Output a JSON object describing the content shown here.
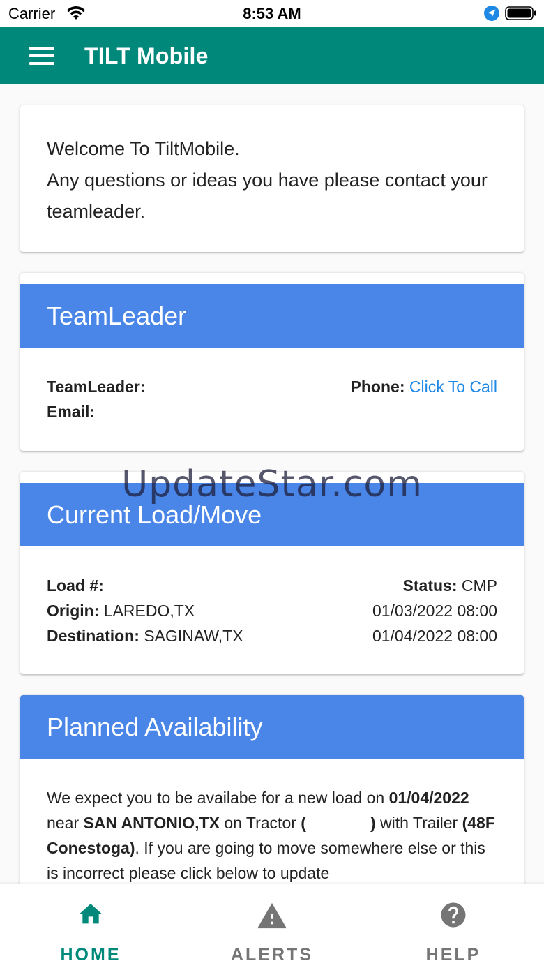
{
  "status_bar": {
    "carrier": "Carrier",
    "time": "8:53 AM"
  },
  "app_bar": {
    "title": "TILT Mobile",
    "menu_icon": "hamburger-menu-icon",
    "color": "#00897B"
  },
  "welcome": {
    "line1": "Welcome To TiltMobile.",
    "line2": "Any questions or ideas you have please contact your teamleader."
  },
  "teamleader": {
    "header": "TeamLeader",
    "teamleader_label": "TeamLeader:",
    "teamleader_value": "",
    "email_label": "Email:",
    "email_value": "",
    "phone_label": "Phone:",
    "phone_link": "Click To Call"
  },
  "current_load": {
    "header": "Current Load/Move",
    "load_label": "Load #:",
    "load_value": "",
    "status_label": "Status:",
    "status_value": "CMP",
    "origin_label": "Origin:",
    "origin_value": "LAREDO,TX",
    "origin_datetime": "01/03/2022 08:00",
    "destination_label": "Destination:",
    "destination_value": "SAGINAW,TX",
    "destination_datetime": "01/04/2022 08:00"
  },
  "planned_availability": {
    "header": "Planned Availability",
    "text_1": "We expect you to be availabe for a new load on ",
    "date": "01/04/2022",
    "text_2": " near ",
    "location": "SAN ANTONIO,TX",
    "text_3": " on Tractor ",
    "tractor_open": "(",
    "tractor_close": ")",
    "text_4": " with Trailer ",
    "trailer": "(48F Conestoga)",
    "text_5": ". If you are going to move somewhere else or this is incorrect please click below to update"
  },
  "watermark": "UpdateStar.com",
  "bottom_nav": {
    "items": [
      {
        "label": "HOME",
        "icon": "home-icon",
        "active": true
      },
      {
        "label": "ALERTS",
        "icon": "warning-icon",
        "active": false
      },
      {
        "label": "HELP",
        "icon": "help-icon",
        "active": false
      }
    ]
  },
  "colors": {
    "primary": "#00897B",
    "card_header": "#4A86E8",
    "link": "#1E88E5",
    "inactive_nav": "#757575"
  }
}
